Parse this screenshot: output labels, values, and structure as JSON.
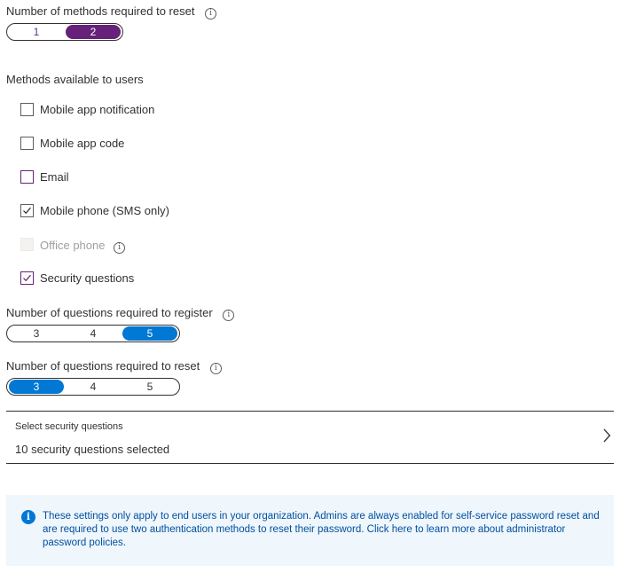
{
  "methods_reset": {
    "label": "Number of methods required to reset",
    "info_icon": "info-icon",
    "options": [
      "1",
      "2"
    ],
    "selected": "2",
    "accent": "#68217a"
  },
  "methods_available": {
    "label": "Methods available to users",
    "items": [
      {
        "label": "Mobile app notification",
        "checked": false
      },
      {
        "label": "Mobile app code",
        "checked": false
      },
      {
        "label": "Email",
        "checked": false
      },
      {
        "label": "Mobile phone (SMS only)",
        "checked": true
      },
      {
        "label": "Office phone",
        "checked": false,
        "disabled": true
      },
      {
        "label": "Security questions",
        "checked": true
      }
    ]
  },
  "questions_register": {
    "label": "Number of questions required to register",
    "options": [
      "3",
      "4",
      "5"
    ],
    "selected": "5",
    "accent": "#0078d4"
  },
  "questions_reset": {
    "label": "Number of questions required to reset",
    "options": [
      "3",
      "4",
      "5"
    ],
    "selected": "3",
    "accent": "#0078d4"
  },
  "select_questions": {
    "title": "Select security questions",
    "value": "10 security questions selected",
    "icon": "chevron-right-icon"
  },
  "notice": {
    "icon": "info-icon",
    "text": "These settings only apply to end users in your organization. Admins are always enabled for self-service password reset and are required to use two authentication methods to reset their password. Click here to learn more about administrator password policies."
  }
}
